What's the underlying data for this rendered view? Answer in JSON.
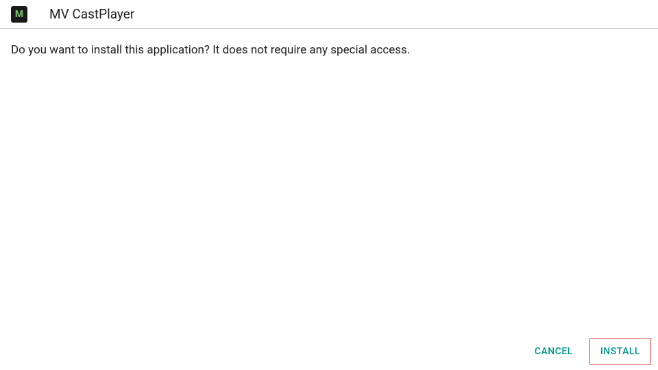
{
  "header": {
    "app_name": "MV CastPlayer",
    "icon_letter": "M"
  },
  "body": {
    "message": "Do you want to install this application? It does not require any special access."
  },
  "actions": {
    "cancel_label": "CANCEL",
    "install_label": "INSTALL"
  },
  "colors": {
    "accent": "#009688",
    "highlight_border": "#d94444"
  }
}
